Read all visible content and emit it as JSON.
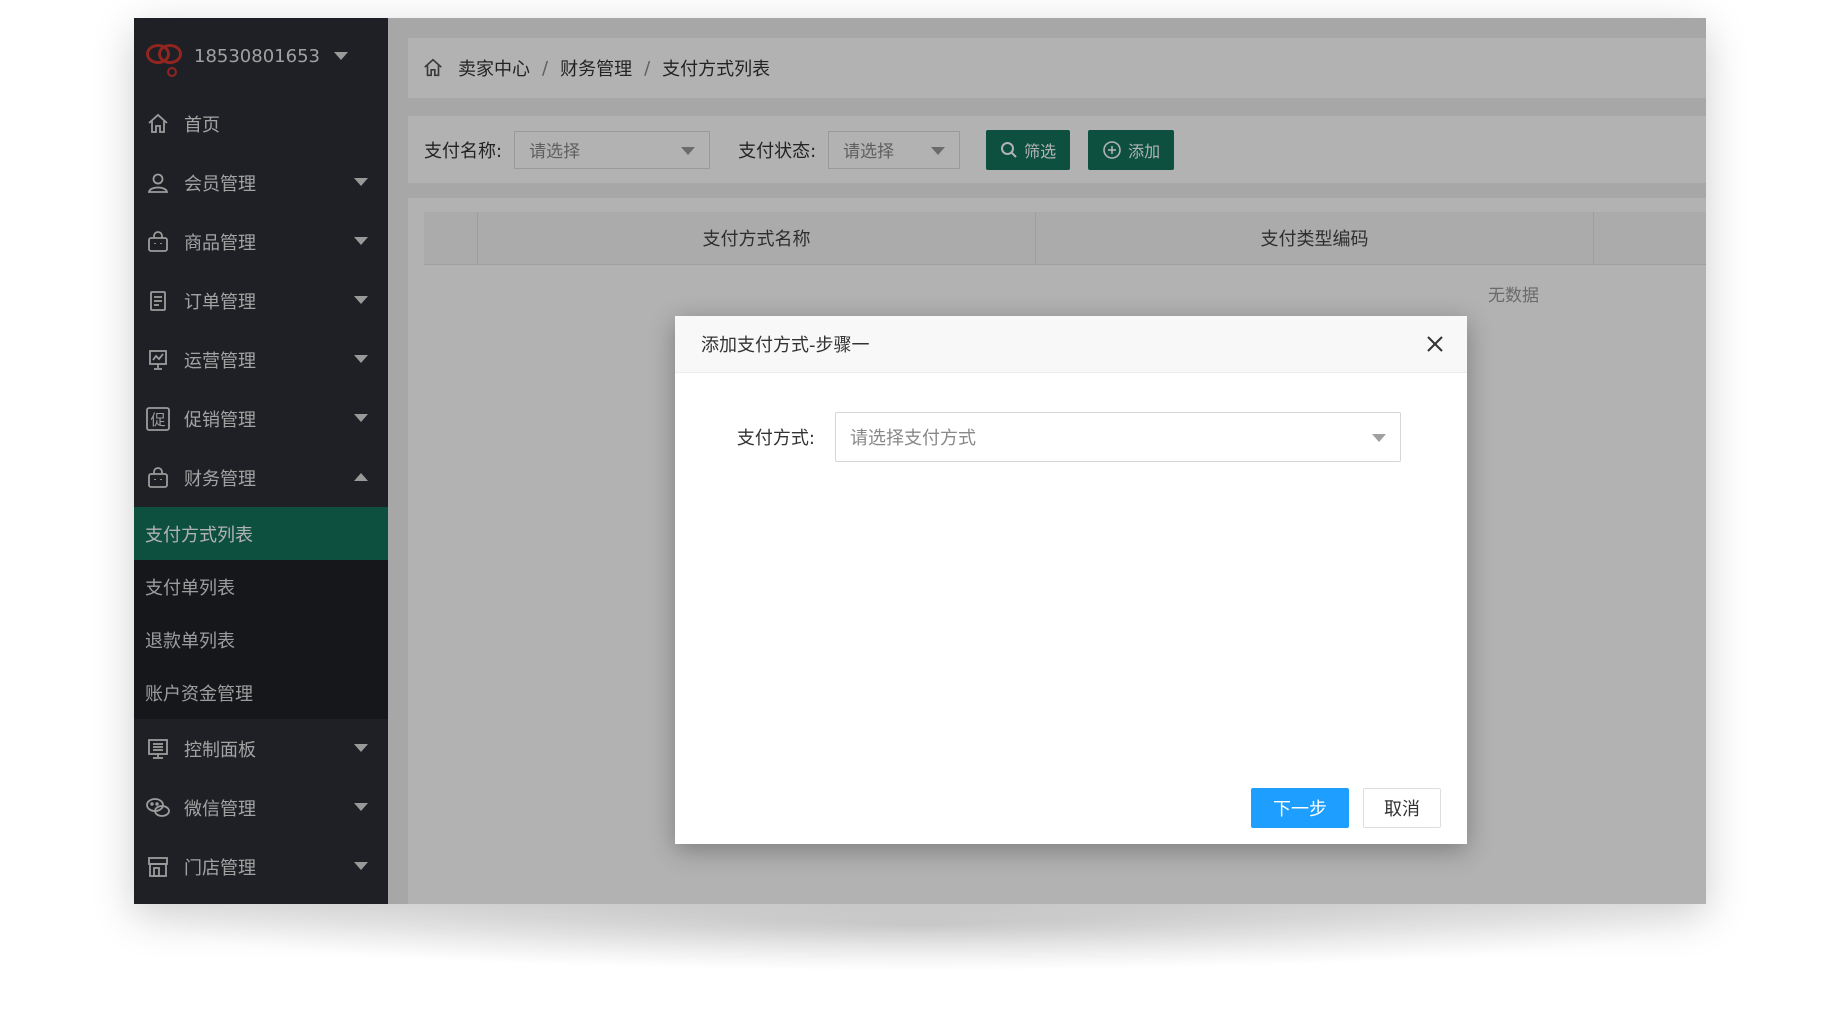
{
  "user": {
    "name": "18530801653"
  },
  "sidebar": {
    "items": [
      {
        "label": "首页",
        "icon": "home-icon",
        "expandable": false
      },
      {
        "label": "会员管理",
        "icon": "user-icon",
        "expandable": true
      },
      {
        "label": "商品管理",
        "icon": "bag-icon",
        "expandable": true
      },
      {
        "label": "订单管理",
        "icon": "order-icon",
        "expandable": true
      },
      {
        "label": "运营管理",
        "icon": "operations-icon",
        "expandable": true
      },
      {
        "label": "促销管理",
        "icon": "promotion-icon",
        "expandable": true
      },
      {
        "label": "财务管理",
        "icon": "finance-icon",
        "expandable": true,
        "expanded": true
      },
      {
        "label": "控制面板",
        "icon": "control-panel-icon",
        "expandable": true
      },
      {
        "label": "微信管理",
        "icon": "wechat-icon",
        "expandable": true
      },
      {
        "label": "门店管理",
        "icon": "store-icon",
        "expandable": true
      }
    ],
    "finance_sub": [
      {
        "label": "支付方式列表",
        "active": true
      },
      {
        "label": "支付单列表",
        "active": false
      },
      {
        "label": "退款单列表",
        "active": false
      },
      {
        "label": "账户资金管理",
        "active": false
      }
    ]
  },
  "breadcrumb": [
    "卖家中心",
    "财务管理",
    "支付方式列表"
  ],
  "breadcrumb_sep": "/",
  "filters": {
    "name_label": "支付名称:",
    "name_placeholder": "请选择",
    "status_label": "支付状态:",
    "status_placeholder": "请选择",
    "filter_button": "筛选",
    "add_button": "添加"
  },
  "table": {
    "columns": [
      "支付方式名称",
      "支付类型编码"
    ],
    "empty_text": "无数据"
  },
  "modal": {
    "title": "添加支付方式-步骤一",
    "field_label": "支付方式:",
    "field_placeholder": "请选择支付方式",
    "next_button": "下一步",
    "cancel_button": "取消"
  },
  "colors": {
    "sidebar_bg": "#2b2f36",
    "active_green": "#13735c",
    "primary_blue": "#1e9fff",
    "logo_red": "#d0362f"
  }
}
